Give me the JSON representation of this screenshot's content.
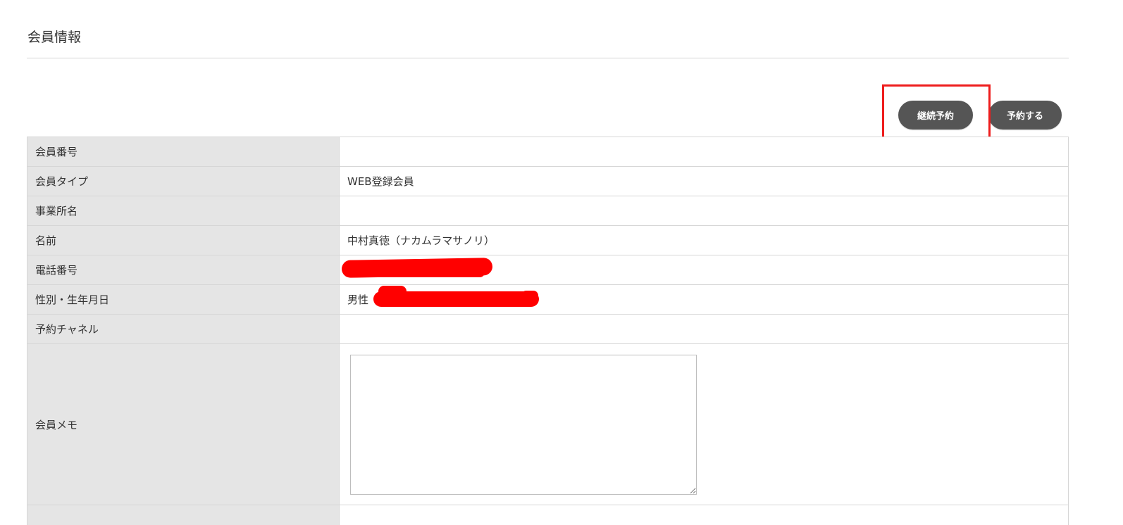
{
  "page": {
    "section_title": "会員情報"
  },
  "toolbar": {
    "continue_label": "継続予約",
    "reserve_label": "予約する"
  },
  "rows": [
    {
      "label": "会員番号",
      "value": ""
    },
    {
      "label": "会員タイプ",
      "value": "WEB登録会員"
    },
    {
      "label": "事業所名",
      "value": ""
    },
    {
      "label": "名前",
      "value": "中村真徳（ナカムラマサノリ）"
    },
    {
      "label": "電話番号",
      "value": ""
    },
    {
      "label": "性別・生年月日",
      "value": "男性"
    },
    {
      "label": "予約チャネル",
      "value": ""
    },
    {
      "label": "会員メモ",
      "value": ""
    }
  ],
  "colors": {
    "button_bg": "#555555",
    "label_bg": "#e5e5e5",
    "highlight": "#ee1c1c",
    "redaction": "#ff0000"
  }
}
